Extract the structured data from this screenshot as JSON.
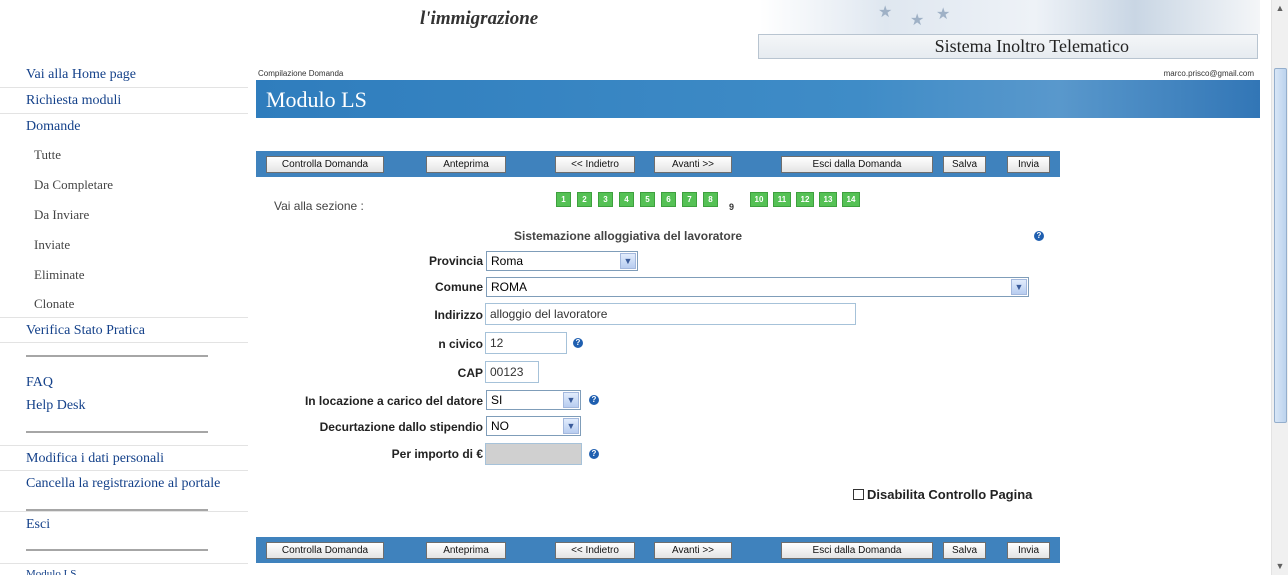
{
  "header": {
    "brand_text": "l'immigrazione",
    "system_title": "Sistema Inoltro Telematico"
  },
  "sidebar": {
    "items": [
      {
        "label": "Vai alla Home page"
      },
      {
        "label": "Richiesta moduli"
      },
      {
        "label": "Domande"
      }
    ],
    "sub_items": [
      "Tutte",
      "Da Completare",
      "Da Inviare",
      "Inviate",
      "Eliminate",
      "Clonate"
    ],
    "verifica": "Verifica Stato Pratica",
    "faq": "FAQ",
    "helpdesk": "Help Desk",
    "modifica": "Modifica i dati personali",
    "cancella": "Cancella la registrazione al portale",
    "esci": "Esci",
    "modulo": "Modulo LS"
  },
  "breadcrumb": "Compilazione Domanda",
  "user_email": "marco.prisco@gmail.com",
  "page_title": "Modulo LS",
  "toolbar": {
    "controlla": "Controlla Domanda",
    "anteprima": "Anteprima",
    "indietro": "<< Indietro",
    "avanti": "Avanti >>",
    "esci": "Esci dalla Domanda",
    "salva": "Salva",
    "invia": "Invia"
  },
  "sections": {
    "label": "Vai alla sezione :",
    "numbers": [
      "1",
      "2",
      "3",
      "4",
      "5",
      "6",
      "7",
      "8",
      "9",
      "10",
      "11",
      "12",
      "13",
      "14"
    ],
    "active": "9"
  },
  "form": {
    "title": "Sistemazione alloggiativa del lavoratore",
    "provincia_label": "Provincia",
    "provincia_value": "Roma",
    "comune_label": "Comune",
    "comune_value": "ROMA",
    "indirizzo_label": "Indirizzo",
    "indirizzo_value": "alloggio del lavoratore",
    "civico_label": "n civico",
    "civico_value": "12",
    "cap_label": "CAP",
    "cap_value": "00123",
    "locazione_label": "In locazione a carico del datore",
    "locazione_value": "SI",
    "decurtazione_label": "Decurtazione dallo stipendio",
    "decurtazione_value": "NO",
    "importo_label": "Per importo di €",
    "importo_value": ""
  },
  "disable_check_label": "Disabilita Controllo Pagina",
  "icons": {
    "help": "help-icon",
    "dropdown": "chevron-down-icon",
    "scroll_up": "arrow-up-icon",
    "scroll_down": "arrow-down-icon"
  },
  "colors": {
    "title_bar": "#3f8cc7",
    "toolbar": "#3f82bd",
    "section_button": "#55c155",
    "sidebar_link": "#14418a",
    "help_icon": "#1f5fb0"
  }
}
